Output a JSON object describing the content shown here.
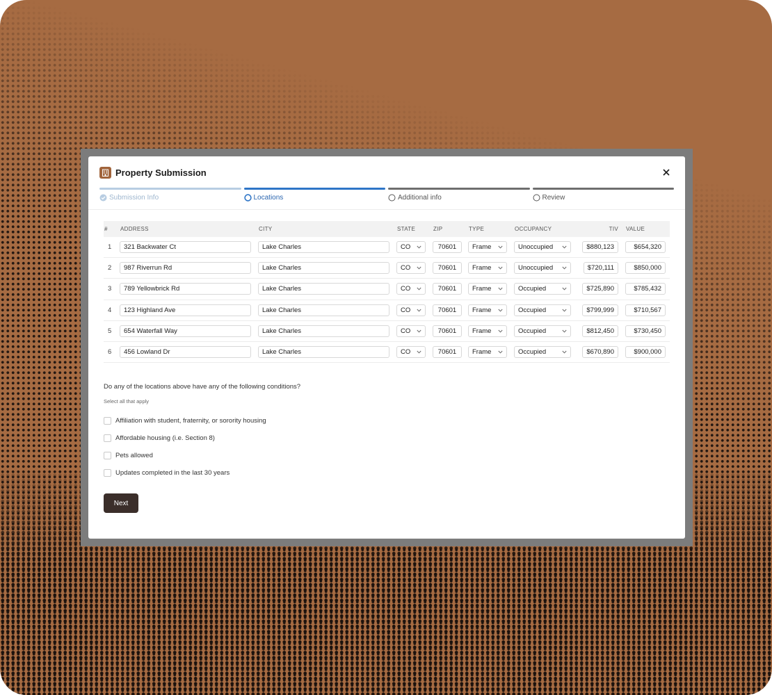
{
  "modal": {
    "title": "Property Submission"
  },
  "steps": [
    {
      "label": "Submission Info",
      "status": "complete"
    },
    {
      "label": "Locations",
      "status": "active"
    },
    {
      "label": "Additional info",
      "status": "pending"
    },
    {
      "label": "Review",
      "status": "pending"
    }
  ],
  "table": {
    "headers": [
      "#",
      "ADDRESS",
      "CITY",
      "STATE",
      "ZIP",
      "TYPE",
      "OCCUPANCY",
      "TIV",
      "VALUE"
    ],
    "rows": [
      {
        "num": "1",
        "address": "321 Backwater Ct",
        "city": "Lake Charles",
        "state": "CO",
        "zip": "70601",
        "type": "Frame",
        "occupancy": "Unoccupied",
        "tiv": "$880,123",
        "value": "$654,320"
      },
      {
        "num": "2",
        "address": "987 Riverrun Rd",
        "city": "Lake Charles",
        "state": "CO",
        "zip": "70601",
        "type": "Frame",
        "occupancy": "Unoccupied",
        "tiv": "$720,111",
        "value": "$850,000"
      },
      {
        "num": "3",
        "address": "789 Yellowbrick Rd",
        "city": "Lake Charles",
        "state": "CO",
        "zip": "70601",
        "type": "Frame",
        "occupancy": "Occupied",
        "tiv": "$725,890",
        "value": "$785,432"
      },
      {
        "num": "4",
        "address": "123 Highland Ave",
        "city": "Lake Charles",
        "state": "CO",
        "zip": "70601",
        "type": "Frame",
        "occupancy": "Occupied",
        "tiv": "$799,999",
        "value": "$710,567"
      },
      {
        "num": "5",
        "address": "654 Waterfall Way",
        "city": "Lake Charles",
        "state": "CO",
        "zip": "70601",
        "type": "Frame",
        "occupancy": "Occupied",
        "tiv": "$812,450",
        "value": "$730,450"
      },
      {
        "num": "6",
        "address": "456 Lowland Dr",
        "city": "Lake Charles",
        "state": "CO",
        "zip": "70601",
        "type": "Frame",
        "occupancy": "Occupied",
        "tiv": "$670,890",
        "value": "$900,000"
      }
    ]
  },
  "conditions": {
    "question": "Do any of the locations above have any of the following conditions?",
    "hint": "Select all that apply",
    "options": [
      "Affiliation with student, fraternity, or sorority housing",
      "Affordable housing (i.e. Section 8)",
      "Pets allowed",
      "Updates completed in the last 30 years"
    ]
  },
  "next_label": "Next",
  "colors": {
    "background": "#a66b42",
    "accent": "#2e75c7",
    "button": "#3b2e2a",
    "brand": "#a1643b"
  }
}
